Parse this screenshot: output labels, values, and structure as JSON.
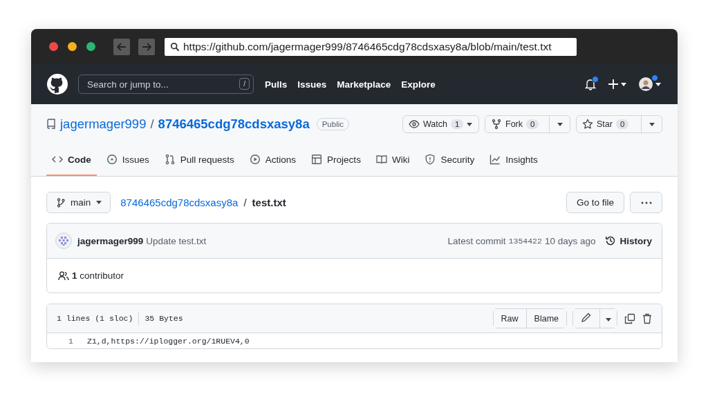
{
  "browser": {
    "url": "https://github.com/jagermager999/8746465cdg78cdsxasy8a/blob/main/test.txt"
  },
  "header": {
    "search": {
      "placeholder": "Search or jump to..."
    },
    "slash_key": "/",
    "nav": [
      "Pulls",
      "Issues",
      "Marketplace",
      "Explore"
    ],
    "notifications_unread": true,
    "avatar_badge": true
  },
  "repo": {
    "owner": "jagermager999",
    "separator": "/",
    "name": "8746465cdg78cdsxasy8a",
    "visibility": "Public",
    "actions": [
      {
        "kind": "watch",
        "label": "Watch",
        "count": "1"
      },
      {
        "kind": "fork",
        "label": "Fork",
        "count": "0"
      },
      {
        "kind": "star",
        "label": "Star",
        "count": "0"
      }
    ]
  },
  "tabs": [
    {
      "kind": "code",
      "label": "Code",
      "selected": true
    },
    {
      "kind": "issues",
      "label": "Issues",
      "selected": false
    },
    {
      "kind": "pulls",
      "label": "Pull requests",
      "selected": false
    },
    {
      "kind": "actions",
      "label": "Actions",
      "selected": false
    },
    {
      "kind": "projects",
      "label": "Projects",
      "selected": false
    },
    {
      "kind": "wiki",
      "label": "Wiki",
      "selected": false
    },
    {
      "kind": "security",
      "label": "Security",
      "selected": false
    },
    {
      "kind": "insights",
      "label": "Insights",
      "selected": false
    }
  ],
  "breadcrumb": {
    "branch": "main",
    "repo": "8746465cdg78cdsxasy8a",
    "separator": "/",
    "file": "test.txt"
  },
  "go_to_file": "Go to file",
  "commit": {
    "author": "jagermager999",
    "message": "Update test.txt",
    "label": "Latest commit",
    "sha": "1354422",
    "time": "10 days ago",
    "history": "History"
  },
  "contributors": {
    "count": "1",
    "label": "contributor"
  },
  "file": {
    "lines": "1 lines (1 sloc)",
    "size": "35 Bytes",
    "buttons": [
      "Raw",
      "Blame"
    ],
    "code": [
      {
        "number": "1",
        "text": "Z1,d,https://iplogger.org/1RUEV4,0"
      }
    ]
  }
}
